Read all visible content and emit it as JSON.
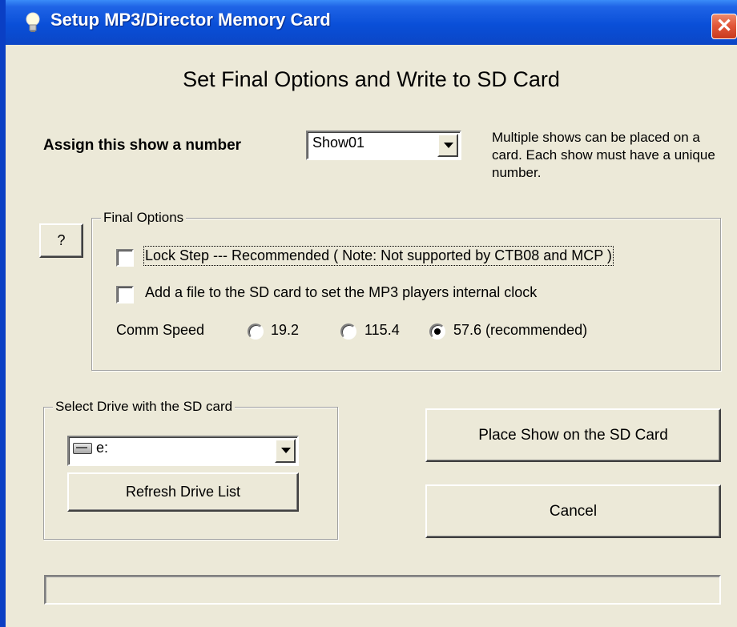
{
  "window": {
    "title": "Setup MP3/Director Memory Card",
    "close_glyph": "✕",
    "title_icon": "lightbulb-icon",
    "accent_color": "#0a4fd8"
  },
  "heading": "Set Final Options and Write to SD Card",
  "show_number": {
    "label": "Assign this show a number",
    "selected": "Show01",
    "note": "Multiple shows can be placed on a card. Each show must have a unique number."
  },
  "help_button_label": "?",
  "final_options": {
    "legend": "Final Options",
    "lock_step": {
      "label": "Lock Step --- Recommended ( Note:  Not supported by CTB08 and MCP )",
      "checked": false
    },
    "clock_file": {
      "label": "Add a file to the SD card to set the MP3 players internal clock",
      "checked": false
    },
    "comm_speed": {
      "label": "Comm Speed",
      "options": [
        {
          "label": "19.2",
          "checked": false
        },
        {
          "label": "115.4",
          "checked": false
        },
        {
          "label": "57.6 (recommended)",
          "checked": true
        }
      ]
    }
  },
  "drive_select": {
    "legend": "Select Drive with the SD card",
    "selected": "e:",
    "drive_icon": "drive-icon",
    "refresh_label": "Refresh Drive List"
  },
  "place_show_label": "Place Show on the SD Card",
  "cancel_label": "Cancel",
  "progress": {
    "value": 0
  }
}
